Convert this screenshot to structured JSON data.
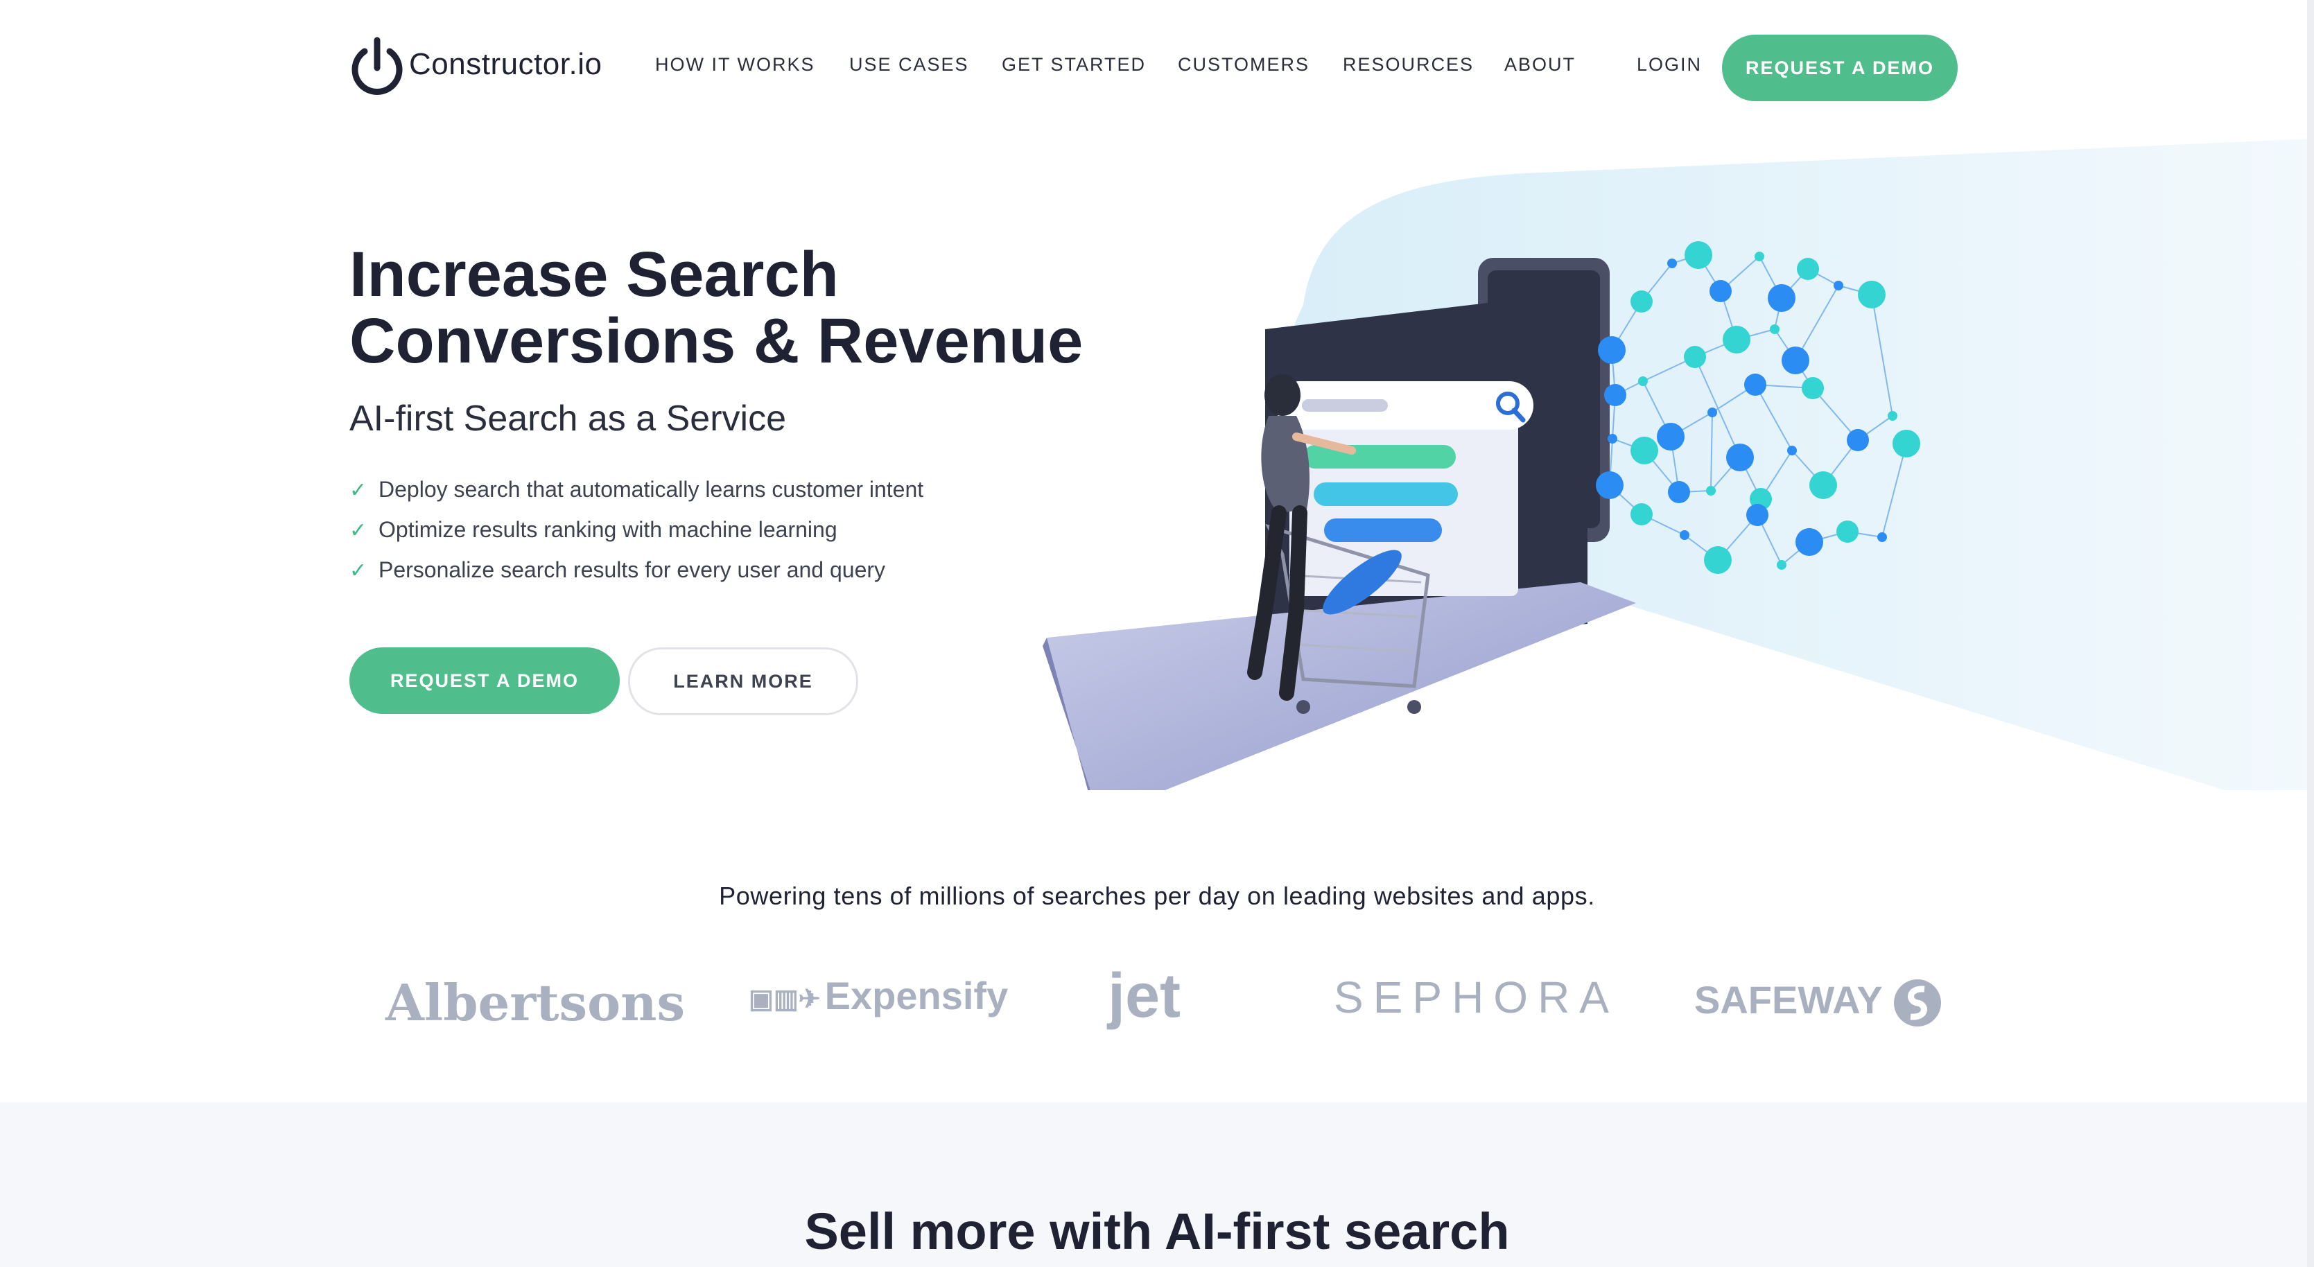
{
  "brand": {
    "logo_text": "Constructor.io",
    "icon": "power-icon"
  },
  "nav": {
    "items": [
      "HOW IT WORKS",
      "USE CASES",
      "GET STARTED",
      "CUSTOMERS",
      "RESOURCES",
      "ABOUT"
    ],
    "login": "LOGIN",
    "cta": "REQUEST A DEMO"
  },
  "hero": {
    "title_line1": "Increase Search",
    "title_line2": "Conversions & Revenue",
    "subtitle": "AI-first Search as a Service",
    "features": [
      "Deploy search that automatically learns customer intent",
      "Optimize results ranking with machine learning",
      "Personalize search results for every user and query"
    ],
    "primary_button": "REQUEST A DEMO",
    "secondary_button": "LEARN MORE"
  },
  "customers": {
    "tagline": "Powering tens of millions of searches per day on leading websites and apps.",
    "logos": [
      "Albertsons",
      "Expensify",
      "jet",
      "SEPHORA",
      "SAFEWAY"
    ]
  },
  "next_section": {
    "title": "Sell more with AI-first search"
  },
  "colors": {
    "accent": "#4fbd8c",
    "text": "#1f2233",
    "logo_gray": "#a9b1c0",
    "network_blue": "#2b8cf3",
    "network_teal": "#33d4d2"
  }
}
